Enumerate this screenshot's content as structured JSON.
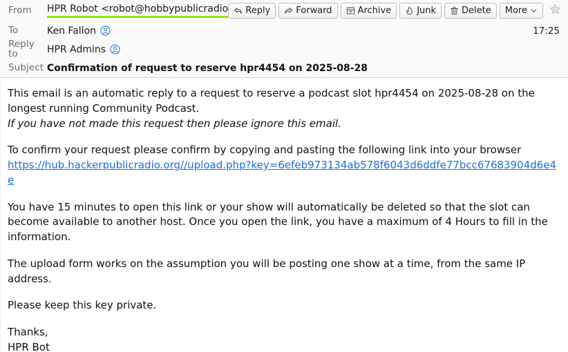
{
  "header": {
    "rows": [
      {
        "label": "From",
        "value": "HPR Robot <robot@hobbypublicradio.com>"
      },
      {
        "label": "To",
        "value": "Ken Fallon"
      },
      {
        "label": "Reply to",
        "value": "HPR Admins"
      },
      {
        "label": "Subject",
        "value": "Confirmation of request to reserve hpr4454 on 2025-08-28"
      }
    ],
    "from_label": "From",
    "from_value": "HPR Robot <robot@hobbypublicradio.com>",
    "to_label": "To",
    "to_value": "Ken Fallon",
    "reply_to_label": "Reply to",
    "reply_to_value": "HPR Admins",
    "subject_label": "Subject",
    "subject_value": "Confirmation of request to reserve hpr4454 on 2025-08-28",
    "time": "17:25",
    "verified_underline_color": "#8ae600",
    "contact_icon_color": "#3b7fd4"
  },
  "toolbar": {
    "reply_label": "Reply",
    "forward_label": "Forward",
    "archive_label": "Archive",
    "junk_label": "Junk",
    "delete_label": "Delete",
    "more_label": "More",
    "star_state": "unstarred"
  },
  "body": {
    "p1": "This email is an automatic reply to a request to reserve a podcast slot hpr4454 on 2025-08-28 on the longest running Community Podcast.",
    "p1_italic": "If you have not made this request then please ignore this email.",
    "p2": "To confirm your request please confirm by copying and pasting the following link into your browser",
    "link": "https://hub.hackerpublicradio.org//upload.php?key=6efeb973134ab578f6043d6ddfe77bcc67683904d6e4e",
    "p3": "You have 15 minutes to open this link or your show will automatically be deleted so that the slot can become available to another host. Once you open the link, you have a maximum of 4 Hours to fill in the information.",
    "p4": "The upload form works on the assumption you will be posting one show at a time, from the same IP address.",
    "p5": "Please keep this key private.",
    "sign_off": "Thanks,",
    "signature": "HPR Bot"
  }
}
